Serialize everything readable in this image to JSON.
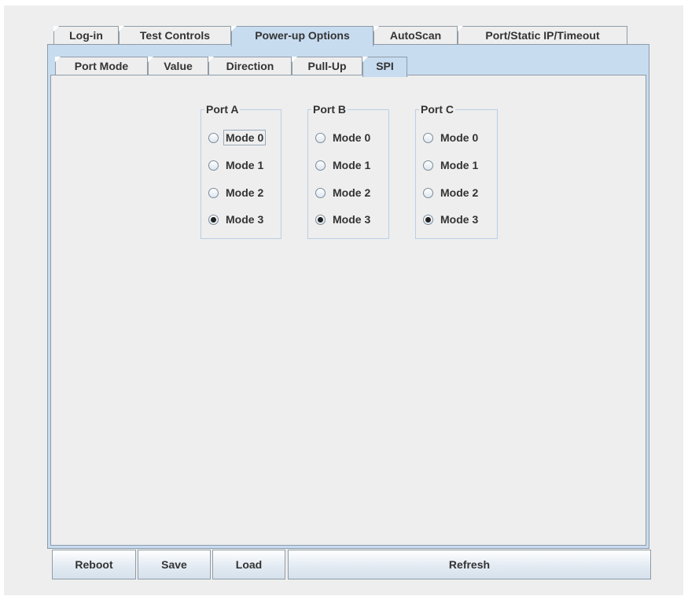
{
  "main_tabs": [
    {
      "label": "Log-in",
      "selected": false
    },
    {
      "label": "Test Controls",
      "selected": false
    },
    {
      "label": "Power-up Options",
      "selected": true
    },
    {
      "label": "AutoScan",
      "selected": false
    },
    {
      "label": "Port/Static IP/Timeout",
      "selected": false
    }
  ],
  "sub_tabs": [
    {
      "label": "Port Mode",
      "selected": false
    },
    {
      "label": "Value",
      "selected": false
    },
    {
      "label": "Direction",
      "selected": false
    },
    {
      "label": "Pull-Up",
      "selected": false
    },
    {
      "label": "SPI",
      "selected": true
    }
  ],
  "ports": [
    {
      "title": "Port A",
      "options": [
        "Mode 0",
        "Mode 1",
        "Mode 2",
        "Mode 3"
      ],
      "selected": "Mode 3",
      "focused": "Mode 0"
    },
    {
      "title": "Port B",
      "options": [
        "Mode 0",
        "Mode 1",
        "Mode 2",
        "Mode 3"
      ],
      "selected": "Mode 3",
      "focused": ""
    },
    {
      "title": "Port C",
      "options": [
        "Mode 0",
        "Mode 1",
        "Mode 2",
        "Mode 3"
      ],
      "selected": "Mode 3",
      "focused": ""
    }
  ],
  "buttons": {
    "reboot": "Reboot",
    "save": "Save",
    "load": "Load",
    "refresh": "Refresh"
  }
}
